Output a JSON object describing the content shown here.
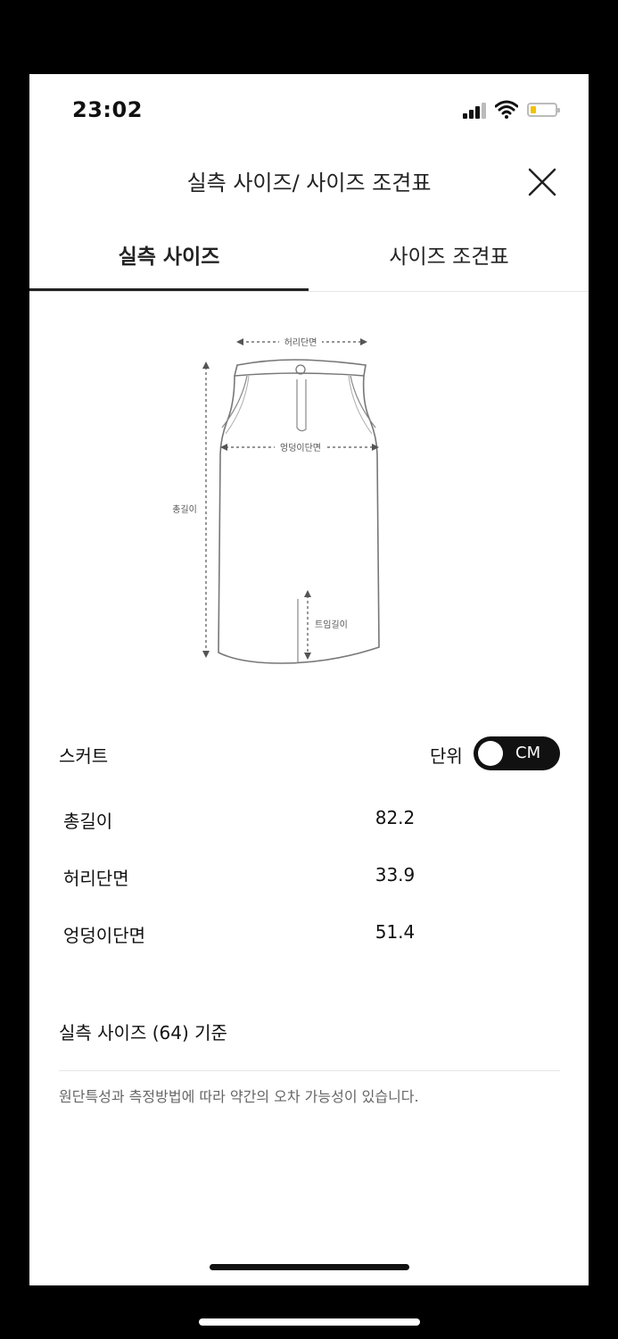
{
  "status_bar": {
    "time": "23:02"
  },
  "header": {
    "title": "실측 사이즈/ 사이즈 조견표"
  },
  "tabs": [
    {
      "label": "실측 사이즈"
    },
    {
      "label": "사이즈 조견표"
    }
  ],
  "diagram": {
    "labels": {
      "waist": "허리단면",
      "hip": "엉덩이단면",
      "total_length": "총길이",
      "slit_length": "트임길이"
    }
  },
  "product": {
    "title": "스커트",
    "unit_label": "단위",
    "unit_value": "CM"
  },
  "measurements": [
    {
      "label": "총길이",
      "value": "82.2"
    },
    {
      "label": "허리단면",
      "value": "33.9"
    },
    {
      "label": "엉덩이단면",
      "value": "51.4"
    }
  ],
  "basis": "실측 사이즈 (64) 기준",
  "note": "원단특성과 측정방법에 따라 약간의 오차 가능성이 있습니다.",
  "colors": {
    "accent": "#111111",
    "battery": "#f2c200"
  }
}
